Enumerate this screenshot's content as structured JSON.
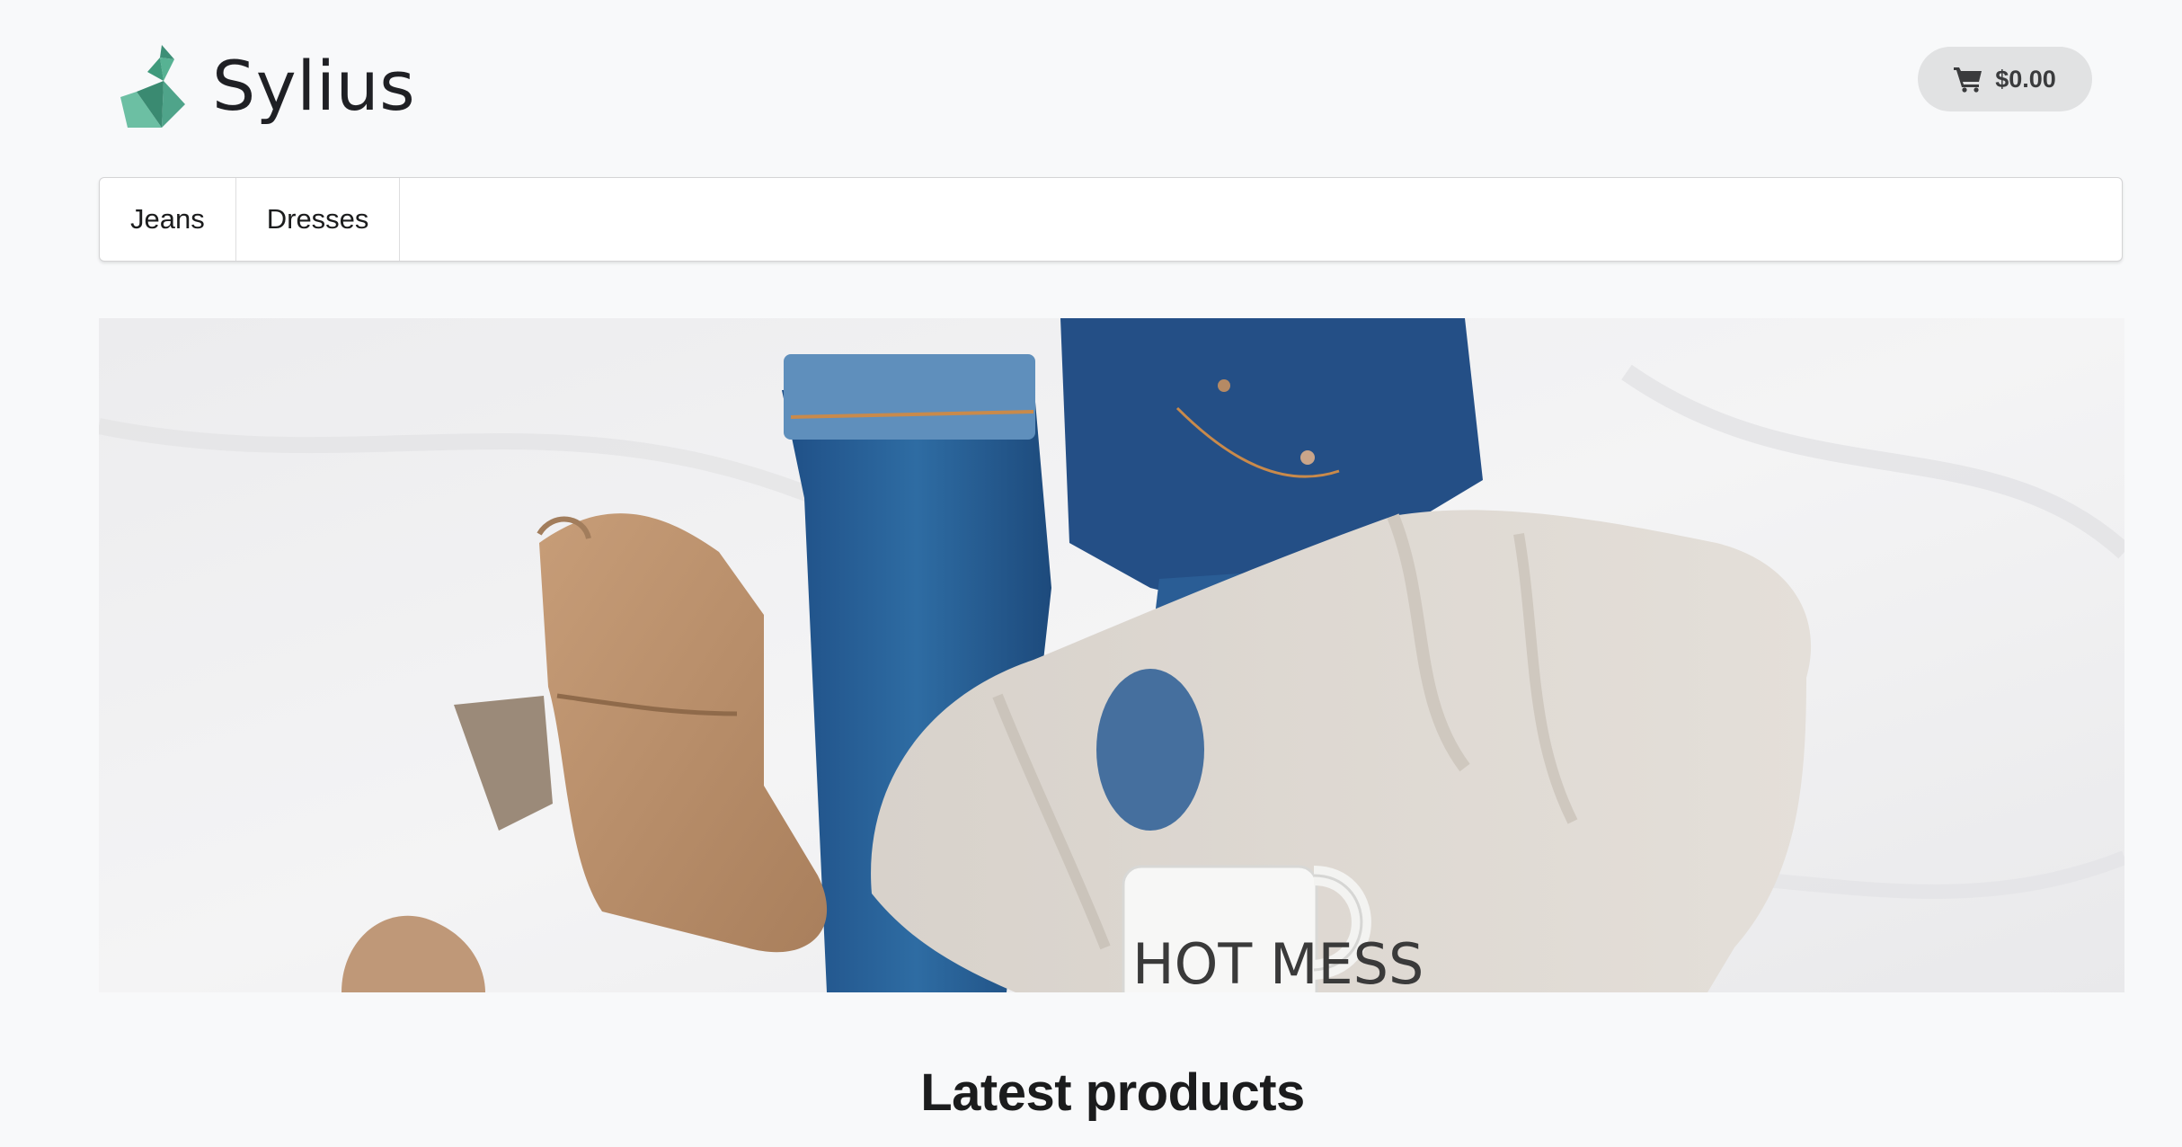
{
  "brand": {
    "name": "Sylius",
    "logo_icon": "swan-logo-icon",
    "logo_color": "#4fa48a"
  },
  "cart": {
    "icon": "shopping-cart-icon",
    "total": "$0.00"
  },
  "menu": {
    "items": [
      {
        "label": "Jeans"
      },
      {
        "label": "Dresses"
      }
    ]
  },
  "hero": {
    "image_subject": "flat-lay: tan suede ankle boots, blue jeans, cream knit sweater, white mug",
    "mug_text": "HOT MESS"
  },
  "sections": {
    "latest_products_title": "Latest products"
  }
}
